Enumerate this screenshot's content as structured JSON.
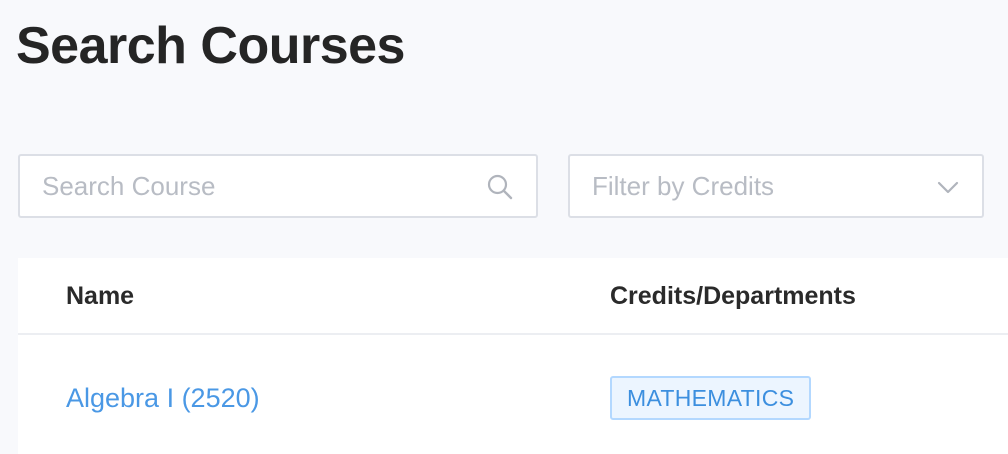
{
  "header": {
    "title": "Search Courses"
  },
  "search": {
    "placeholder": "Search Course",
    "value": ""
  },
  "filter": {
    "placeholder": "Filter by Credits",
    "icon": "chevron-down-icon"
  },
  "table": {
    "columns": [
      "Name",
      "Credits/Departments"
    ],
    "rows": [
      {
        "name": "Algebra I (2520)",
        "department": "MATHEMATICS"
      }
    ]
  },
  "colors": {
    "link": "#4a98e5",
    "tag_text": "#3c8fdf",
    "tag_bg": "#ecf5ff",
    "tag_border": "#b3d8ff",
    "page_bg": "#f8f9fc"
  }
}
